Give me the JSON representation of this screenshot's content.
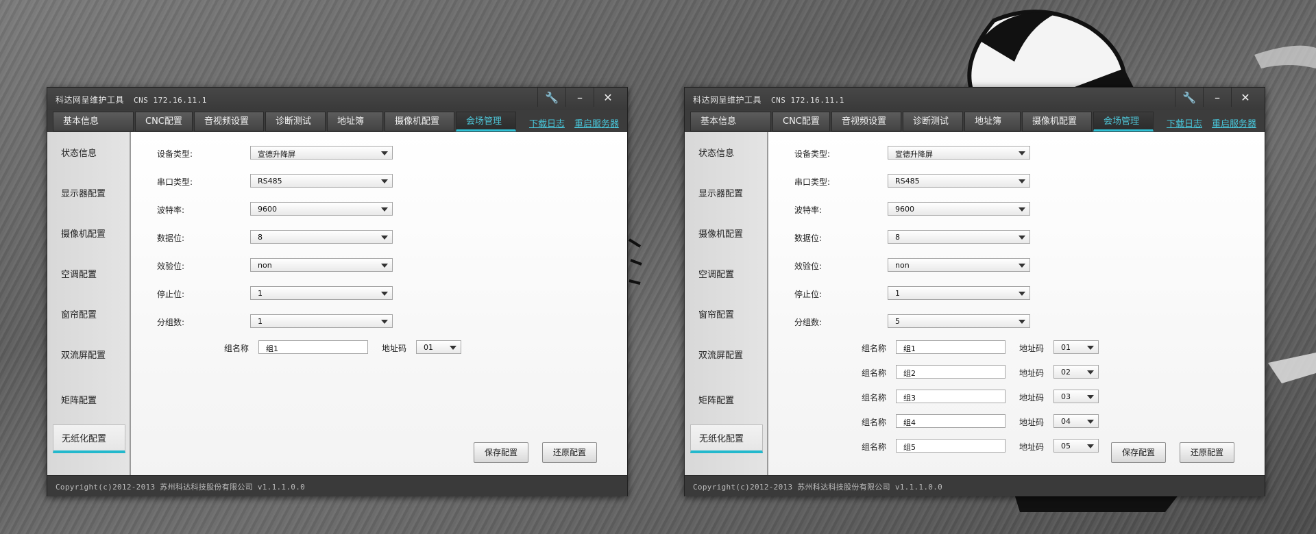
{
  "app": {
    "title": "科达网呈维护工具",
    "ip": "CNS 172.16.11.1",
    "tabs": [
      "基本信息",
      "CNC配置",
      "音视频设置",
      "诊断测试",
      "地址簿",
      "摄像机配置",
      "会场管理"
    ],
    "active_tab": "会场管理",
    "links": [
      "下载日志",
      "重启服务器"
    ],
    "sidebar": [
      "状态信息",
      "显示器配置",
      "摄像机配置",
      "空调配置",
      "窗帘配置",
      "双流屏配置",
      "矩阵配置",
      "无纸化配置"
    ],
    "active_sidebar": "无纸化配置",
    "labels": {
      "device_type": "设备类型:",
      "serial_type": "串口类型:",
      "baud": "波特率:",
      "data_bits": "数据位:",
      "parity": "效验位:",
      "stop_bits": "停止位:",
      "group_count": "分组数:",
      "group_name": "组名称",
      "address": "地址码"
    },
    "buttons": {
      "save": "保存配置",
      "restore": "还原配置"
    },
    "footer": "Copyright(c)2012-2013 苏州科达科技股份有限公司 v1.1.1.0.0",
    "accent": "#2fc0d4"
  },
  "windows": [
    {
      "fields": {
        "device_type": "宣德升降屏",
        "serial_type": "RS485",
        "baud": "9600",
        "data_bits": "8",
        "parity": "non",
        "stop_bits": "1",
        "group_count": "1"
      },
      "groups": [
        {
          "name": "组1",
          "address": "01"
        }
      ]
    },
    {
      "fields": {
        "device_type": "宣德升降屏",
        "serial_type": "RS485",
        "baud": "9600",
        "data_bits": "8",
        "parity": "non",
        "stop_bits": "1",
        "group_count": "5"
      },
      "groups": [
        {
          "name": "组1",
          "address": "01"
        },
        {
          "name": "组2",
          "address": "02"
        },
        {
          "name": "组3",
          "address": "03"
        },
        {
          "name": "组4",
          "address": "04"
        },
        {
          "name": "组5",
          "address": "05"
        }
      ]
    }
  ]
}
